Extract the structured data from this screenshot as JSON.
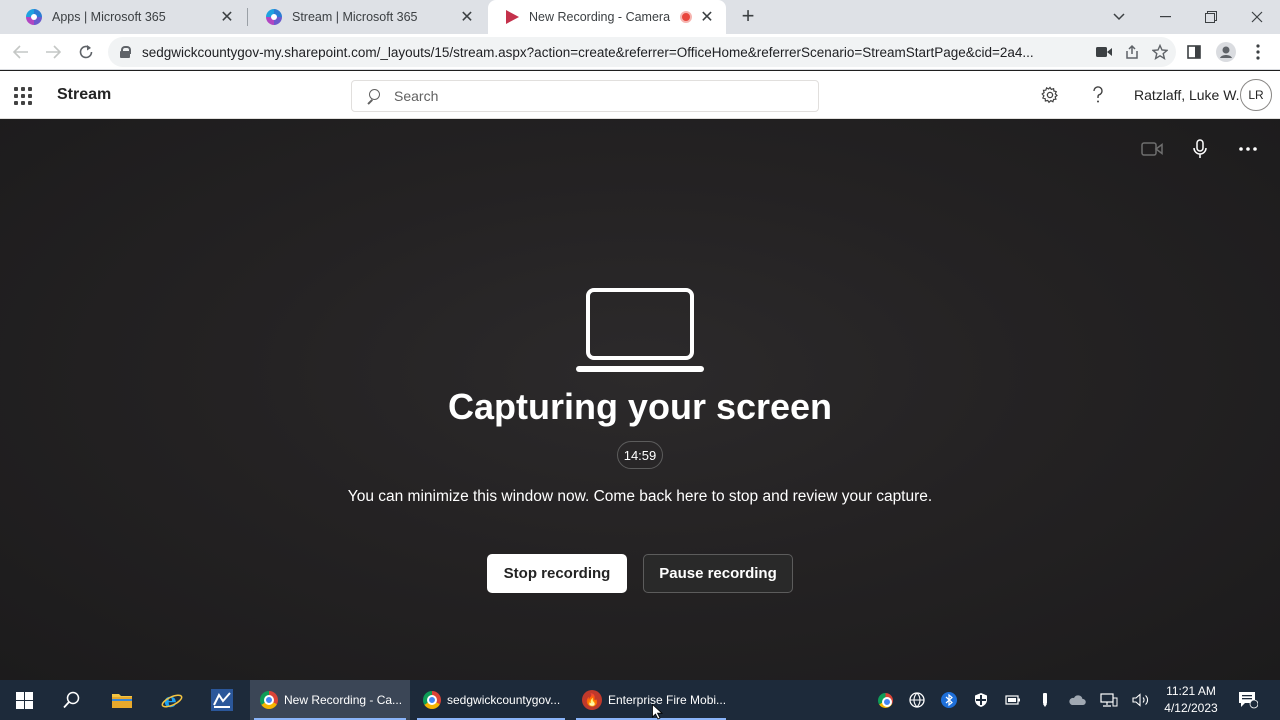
{
  "browser": {
    "tabs": [
      {
        "title": "Apps | Microsoft 365",
        "icon": "m365-icon",
        "active": false
      },
      {
        "title": "Stream | Microsoft 365",
        "icon": "m365-icon",
        "active": false
      },
      {
        "title": "New Recording - Camera",
        "icon": "stream-icon",
        "active": true,
        "recording": true
      }
    ],
    "url": "sedgwickcountygov-my.sharepoint.com/_layouts/15/stream.aspx?action=create&referrer=OfficeHome&referrerScenario=StreamStartPage&cid=2a4..."
  },
  "app": {
    "name": "Stream",
    "search_placeholder": "Search",
    "user_name": "Ratzlaff, Luke W.",
    "user_initials": "LR"
  },
  "capture": {
    "title": "Capturing your screen",
    "timer": "14:59",
    "message": "You can minimize this window now. Come back here to stop and review your capture.",
    "stop_label": "Stop recording",
    "pause_label": "Pause recording"
  },
  "taskbar": {
    "apps": [
      {
        "label": "New Recording - Ca...",
        "icon": "chrome-icon",
        "active": true
      },
      {
        "label": "sedgwickcountygov...",
        "icon": "chrome-icon",
        "active": false
      },
      {
        "label": "Enterprise Fire Mobi...",
        "icon": "fire-icon",
        "active": false
      }
    ],
    "time": "11:21 AM",
    "date": "4/12/2023"
  },
  "colors": {
    "stage_bg": "#242223",
    "taskbar_bg": "#1d2a3a",
    "recording_red": "#e8453c",
    "stream_red": "#c4314b"
  }
}
